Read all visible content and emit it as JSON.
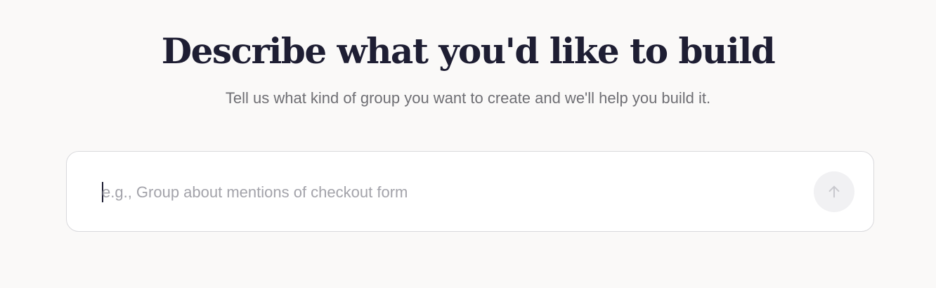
{
  "header": {
    "title": "Describe what you'd like to build",
    "subtitle": "Tell us what kind of group you want to create and we'll help you build it."
  },
  "prompt": {
    "value": "",
    "placeholder": "e.g., Group about mentions of checkout form",
    "submit_icon": "arrow-up-icon"
  },
  "colors": {
    "background": "#faf9f8",
    "title": "#1e1e33",
    "subtitle": "#6f6f74",
    "placeholder": "#a3a3aa",
    "submit_disabled": "#f1f1f3"
  }
}
